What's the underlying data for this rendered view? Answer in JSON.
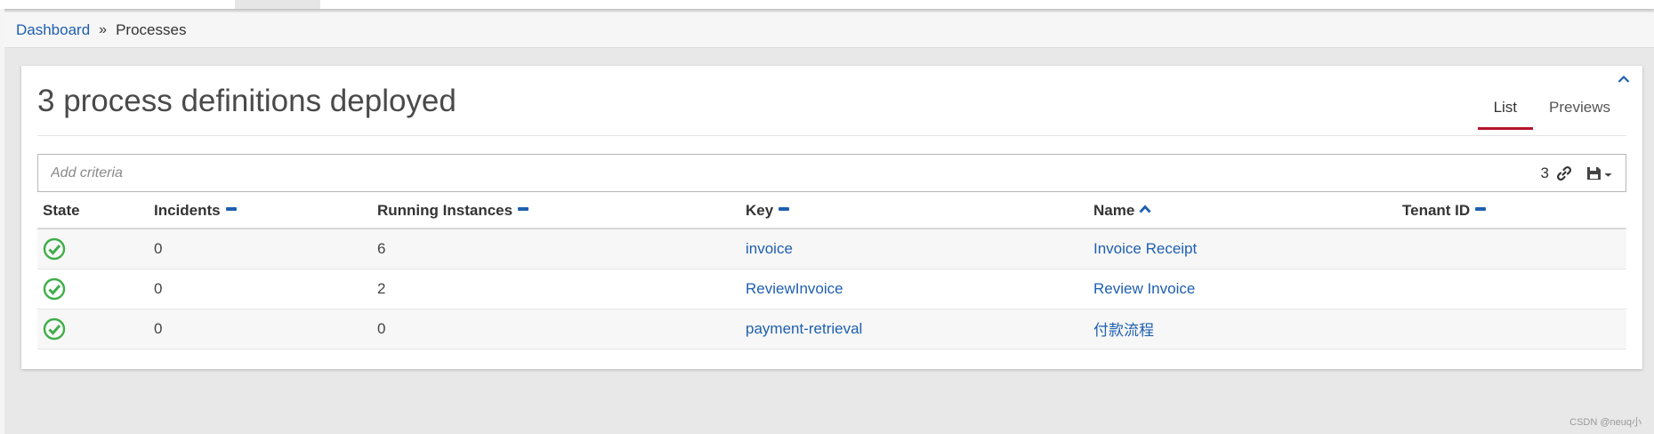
{
  "breadcrumb": {
    "dashboard": "Dashboard",
    "separator": "»",
    "current": "Processes"
  },
  "panel": {
    "title": "3 process definitions deployed",
    "tabs": [
      {
        "label": "List",
        "active": true
      },
      {
        "label": "Previews",
        "active": false
      }
    ],
    "collapse_icon": "chevron-up-icon"
  },
  "search": {
    "placeholder": "Add criteria",
    "count": "3",
    "link_icon": "link-icon",
    "save_icon": "save-icon"
  },
  "table": {
    "columns": [
      {
        "label": "State",
        "sort": "none"
      },
      {
        "label": "Incidents",
        "sort": "neutral"
      },
      {
        "label": "Running Instances",
        "sort": "neutral"
      },
      {
        "label": "Key",
        "sort": "neutral"
      },
      {
        "label": "Name",
        "sort": "asc"
      },
      {
        "label": "Tenant ID",
        "sort": "neutral"
      }
    ],
    "rows": [
      {
        "state": "ok",
        "incidents": "0",
        "running": "6",
        "key": "invoice",
        "name": "Invoice Receipt",
        "tenant": ""
      },
      {
        "state": "ok",
        "incidents": "0",
        "running": "2",
        "key": "ReviewInvoice",
        "name": "Review Invoice",
        "tenant": ""
      },
      {
        "state": "ok",
        "incidents": "0",
        "running": "0",
        "key": "payment-retrieval",
        "name": "付款流程",
        "tenant": ""
      }
    ]
  },
  "watermark": "CSDN @neuq小",
  "colors": {
    "link": "#1f5fb0",
    "active_tab": "#b5152b",
    "state_ok": "#3fae49"
  }
}
